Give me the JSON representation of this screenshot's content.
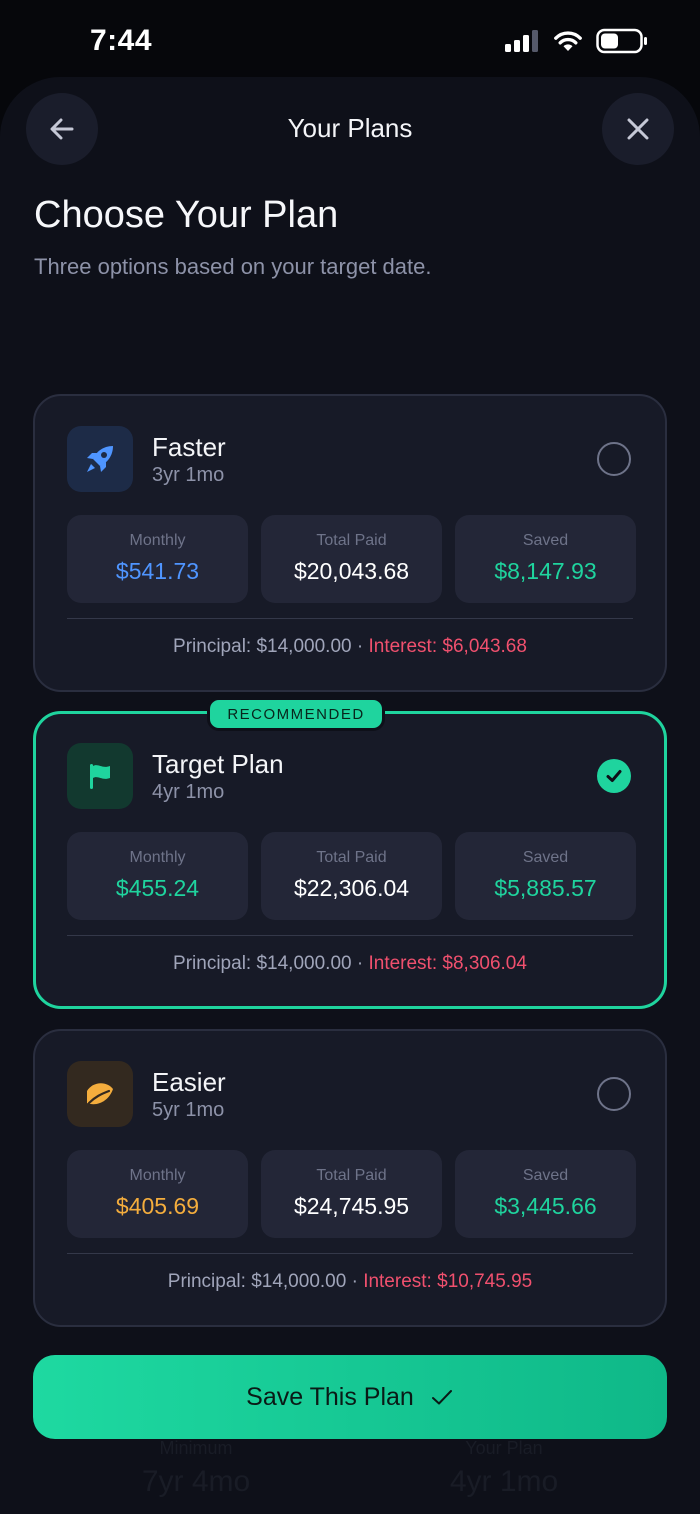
{
  "status": {
    "time": "7:44"
  },
  "nav": {
    "title": "Your Plans"
  },
  "header": {
    "title": "Choose Your Plan",
    "subtitle": "Three options based on your target date."
  },
  "labels": {
    "monthly": "Monthly",
    "total_paid": "Total Paid",
    "saved": "Saved",
    "principal": "Principal:",
    "interest": "Interest:"
  },
  "badge": "RECOMMENDED",
  "plans": [
    {
      "name": "Faster",
      "duration": "3yr 1mo",
      "icon": "rocket-icon",
      "selected": false,
      "monthly": "$541.73",
      "total_paid": "$20,043.68",
      "saved": "$8,147.93",
      "principal": "$14,000.00",
      "interest": "$6,043.68",
      "accent": "#4f95ff"
    },
    {
      "name": "Target Plan",
      "duration": "4yr 1mo",
      "icon": "flag-icon",
      "selected": true,
      "monthly": "$455.24",
      "total_paid": "$22,306.04",
      "saved": "$5,885.57",
      "principal": "$14,000.00",
      "interest": "$8,306.04",
      "accent": "#1fd49e"
    },
    {
      "name": "Easier",
      "duration": "5yr 1mo",
      "icon": "leaf-icon",
      "selected": false,
      "monthly": "$405.69",
      "total_paid": "$24,745.95",
      "saved": "$3,445.66",
      "principal": "$14,000.00",
      "interest": "$10,745.95",
      "accent": "#f4ad3d"
    }
  ],
  "behind_button": {
    "left_label": "Minimum",
    "left_value": "7yr 4mo",
    "right_label": "Your Plan",
    "right_value": "4yr 1mo"
  },
  "save_button": "Save This Plan",
  "colors": {
    "green": "#1fd49e",
    "blue": "#4f95ff",
    "orange": "#f4ad3d",
    "red": "#f0506e"
  }
}
